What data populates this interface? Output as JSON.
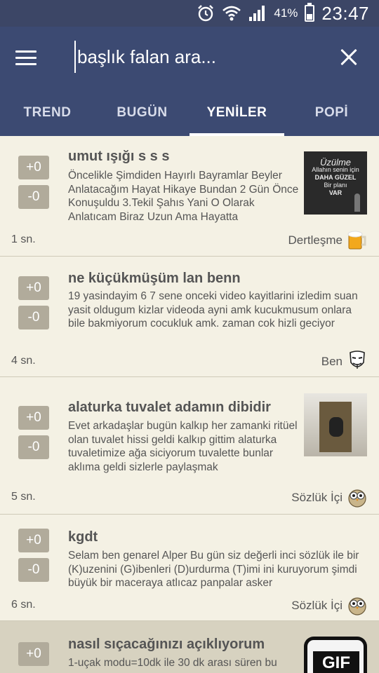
{
  "status_bar": {
    "battery": "41%",
    "time": "23:47",
    "icons": [
      "alarm-icon",
      "wifi-icon",
      "signal-icon",
      "battery-icon"
    ],
    "battery_level": 0.41
  },
  "search": {
    "placeholder": "başlık falan ara..."
  },
  "tabs": [
    {
      "label": "TREND"
    },
    {
      "label": "BUGÜN"
    },
    {
      "label": "YENİLER",
      "active": true
    },
    {
      "label": "POPİ"
    }
  ],
  "posts": [
    {
      "title": "umut ışığı s s s",
      "up": "+0",
      "down": "-0",
      "body": "Öncelikle Şimdiden Hayırlı Bayramlar Beyler Anlatacağım Hayat Hikaye Bundan 2 Gün Önce Konuşuldu 3.Tekil Şahıs Yani O Olarak Anlatıcam Biraz Uzun Ama Hayatta",
      "time": "1 sn.",
      "category": "Dertleşme",
      "category_icon": "beer-mug-icon",
      "thumbnail": {
        "lines": [
          "Üzülme",
          "Allahın senin için",
          "DAHA GÜZEL",
          "Bir planı",
          "VAR"
        ]
      }
    },
    {
      "title": "ne küçükmüşüm lan benn",
      "up": "+0",
      "down": "-0",
      "body": "19 yasindayim 6 7 sene onceki video kayitlarini izledim suan yasit oldugum kizlar videoda ayni amk kucukmusum onlara bile bakmiyorum cocukluk amk. zaman cok hizli geciyor",
      "time": "4 sn.",
      "category": "Ben",
      "category_icon": "mask-icon"
    },
    {
      "title": "alaturka tuvalet adamın dibidir",
      "up": "+0",
      "down": "-0",
      "body": "Evet arkadaşlar bugün kalkıp her zamanki ritüel olan tuvalet hissi geldi kalkıp gittim alaturka tuvaletimize ağa siciyorum tuvalette bunlar aklıma geldi sizlerle paylaşmak",
      "time": "5 sn.",
      "category": "Sözlük İçi",
      "category_icon": "owl-icon",
      "thumbnail": {
        "lines": []
      }
    },
    {
      "title": "kgdt",
      "up": "+0",
      "down": "-0",
      "body": "Selam ben genarel Alper Bu gün siz değerli inci sözlük ile bir (K)uzenini (G)ibenleri (D)urdurma (T)imi ini kuruyorum şimdi büyük bir maceraya atlıcaz panpalar asker",
      "time": "6 sn.",
      "category": "Sözlük İçi",
      "category_icon": "owl-icon"
    },
    {
      "title": "nasıl sıçacağınızı açıklıyorum",
      "up": "+0",
      "down": "-0",
      "body": "1-uçak modu=10dk ile 30 dk arası süren bu",
      "thumbnail": {
        "lines": [
          "GIF"
        ]
      }
    }
  ]
}
